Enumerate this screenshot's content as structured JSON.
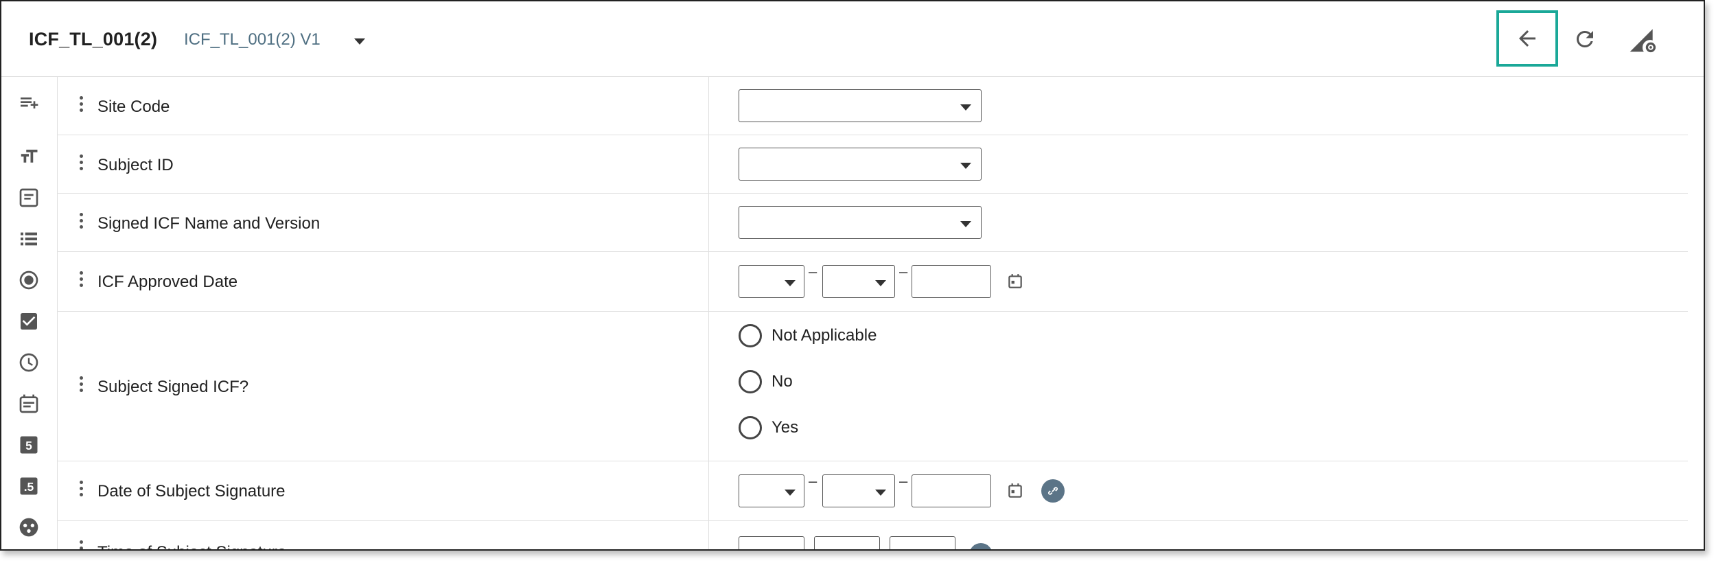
{
  "header": {
    "form_title": "ICF_TL_001(2)",
    "version_label": "ICF_TL_001(2) V1",
    "icons": [
      "arrow-back-icon",
      "refresh-icon",
      "signal-settings-icon"
    ],
    "accent_color": "#1aa898"
  },
  "toolbar": {
    "icons": [
      "add-list-icon",
      "text-size-icon",
      "text-area-icon",
      "list-icon",
      "radio-icon",
      "checkbox-icon",
      "clock-icon",
      "calendar-icon",
      "number-icon",
      "decimal-icon",
      "group-icon"
    ],
    "number_glyph": "5",
    "decimal_glyph": ".5"
  },
  "form": {
    "fields": [
      {
        "label": "Site Code",
        "type": "select"
      },
      {
        "label": "Subject ID",
        "type": "select"
      },
      {
        "label": "Signed ICF Name and Version",
        "type": "select"
      },
      {
        "label": "ICF Approved Date",
        "type": "date"
      },
      {
        "label": "Subject Signed ICF?",
        "type": "radio",
        "options": [
          "Not Applicable",
          "No",
          "Yes"
        ]
      },
      {
        "label": "Date of Subject Signature",
        "type": "date"
      },
      {
        "label": "Time of Subject Signature",
        "type": "time"
      }
    ],
    "date_separator": "–"
  }
}
